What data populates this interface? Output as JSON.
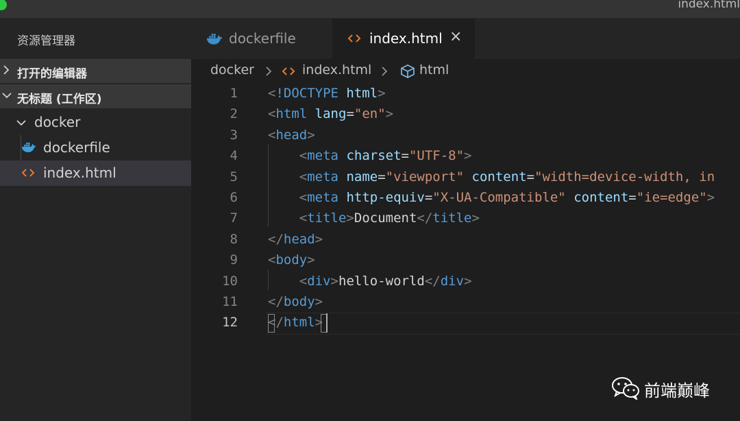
{
  "window": {
    "title": "index.html"
  },
  "sidebar": {
    "title": "资源管理器",
    "sections": [
      {
        "label": "打开的编辑器",
        "expanded": false
      },
      {
        "label": "无标题 (工作区)",
        "expanded": true
      }
    ],
    "tree": [
      {
        "label": "docker",
        "type": "folder",
        "expanded": true
      },
      {
        "label": "dockerfile",
        "type": "file",
        "icon": "docker-icon"
      },
      {
        "label": "index.html",
        "type": "file",
        "icon": "html-code-icon",
        "selected": true
      }
    ]
  },
  "tabs": [
    {
      "label": "dockerfile",
      "icon": "docker-icon",
      "active": false
    },
    {
      "label": "index.html",
      "icon": "html-code-icon",
      "active": true,
      "close": "×"
    }
  ],
  "breadcrumb": [
    "docker",
    "index.html",
    "html"
  ],
  "editor": {
    "current_line": 12,
    "lines": [
      {
        "n": "1",
        "tokens": [
          [
            "punc",
            "<"
          ],
          [
            "tag",
            "!DOCTYPE"
          ],
          [
            "txt",
            " "
          ],
          [
            "attr",
            "html"
          ],
          [
            "punc",
            ">"
          ]
        ]
      },
      {
        "n": "2",
        "tokens": [
          [
            "punc",
            "<"
          ],
          [
            "tag",
            "html"
          ],
          [
            "txt",
            " "
          ],
          [
            "attr",
            "lang"
          ],
          [
            "txt",
            "="
          ],
          [
            "str",
            "\"en\""
          ],
          [
            "punc",
            ">"
          ]
        ]
      },
      {
        "n": "3",
        "tokens": [
          [
            "punc",
            "<"
          ],
          [
            "tag",
            "head"
          ],
          [
            "punc",
            ">"
          ]
        ]
      },
      {
        "n": "4",
        "tokens": [
          [
            "txt",
            "    "
          ],
          [
            "punc",
            "<"
          ],
          [
            "tag",
            "meta"
          ],
          [
            "txt",
            " "
          ],
          [
            "attr",
            "charset"
          ],
          [
            "txt",
            "="
          ],
          [
            "str",
            "\"UTF-8\""
          ],
          [
            "punc",
            ">"
          ]
        ]
      },
      {
        "n": "5",
        "tokens": [
          [
            "txt",
            "    "
          ],
          [
            "punc",
            "<"
          ],
          [
            "tag",
            "meta"
          ],
          [
            "txt",
            " "
          ],
          [
            "attr",
            "name"
          ],
          [
            "txt",
            "="
          ],
          [
            "str",
            "\"viewport\""
          ],
          [
            "txt",
            " "
          ],
          [
            "attr",
            "content"
          ],
          [
            "txt",
            "="
          ],
          [
            "str",
            "\"width=device-width, in"
          ]
        ]
      },
      {
        "n": "6",
        "tokens": [
          [
            "txt",
            "    "
          ],
          [
            "punc",
            "<"
          ],
          [
            "tag",
            "meta"
          ],
          [
            "txt",
            " "
          ],
          [
            "attr",
            "http-equiv"
          ],
          [
            "txt",
            "="
          ],
          [
            "str",
            "\"X-UA-Compatible\""
          ],
          [
            "txt",
            " "
          ],
          [
            "attr",
            "content"
          ],
          [
            "txt",
            "="
          ],
          [
            "str",
            "\"ie=edge\""
          ],
          [
            "punc",
            ">"
          ]
        ]
      },
      {
        "n": "7",
        "tokens": [
          [
            "txt",
            "    "
          ],
          [
            "punc",
            "<"
          ],
          [
            "tag",
            "title"
          ],
          [
            "punc",
            ">"
          ],
          [
            "txt",
            "Document"
          ],
          [
            "punc",
            "</"
          ],
          [
            "tag",
            "title"
          ],
          [
            "punc",
            ">"
          ]
        ]
      },
      {
        "n": "8",
        "tokens": [
          [
            "punc",
            "</"
          ],
          [
            "tag",
            "head"
          ],
          [
            "punc",
            ">"
          ]
        ]
      },
      {
        "n": "9",
        "tokens": [
          [
            "punc",
            "<"
          ],
          [
            "tag",
            "body"
          ],
          [
            "punc",
            ">"
          ]
        ]
      },
      {
        "n": "10",
        "tokens": [
          [
            "txt",
            "    "
          ],
          [
            "punc",
            "<"
          ],
          [
            "tag",
            "div"
          ],
          [
            "punc",
            ">"
          ],
          [
            "txt",
            "hello-world"
          ],
          [
            "punc",
            "</"
          ],
          [
            "tag",
            "div"
          ],
          [
            "punc",
            ">"
          ]
        ]
      },
      {
        "n": "11",
        "tokens": [
          [
            "punc",
            "</"
          ],
          [
            "tag",
            "body"
          ],
          [
            "punc",
            ">"
          ]
        ]
      },
      {
        "n": "12",
        "tokens": [
          [
            "punc",
            "</"
          ],
          [
            "tag",
            "html"
          ],
          [
            "punc",
            ">"
          ]
        ]
      }
    ]
  },
  "watermark": {
    "text": "前端巅峰",
    "icon": "wechat-icon"
  },
  "colors": {
    "editor_bg": "#1e1e1e",
    "sidebar_bg": "#252526",
    "tag": "#569cd6",
    "attr": "#9cdcfe",
    "string": "#ce9178",
    "punctuation": "#808080"
  }
}
